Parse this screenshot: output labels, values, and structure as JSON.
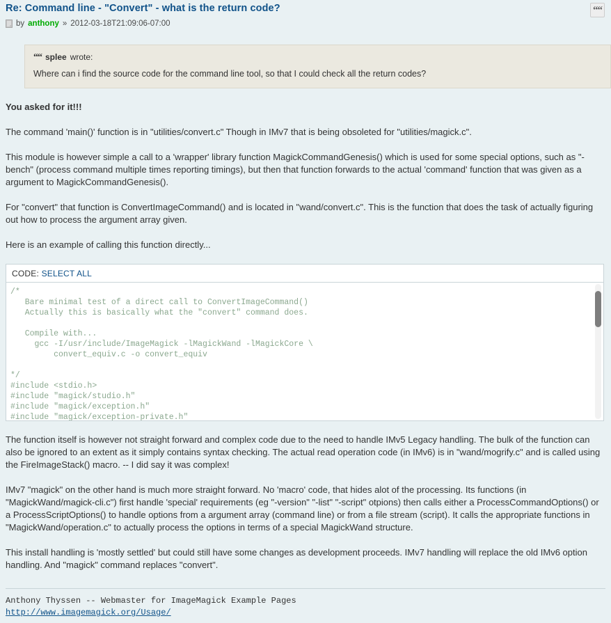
{
  "post": {
    "title": "Re: Command line - \"Convert\" - what is the return code?",
    "byline_prefix": "by",
    "author": "anthony",
    "separator": "»",
    "date": "2012-03-18T21:09:06-07:00",
    "post_icon_name": "post-page-icon",
    "quote_button_glyph": "“",
    "quote_button_name": "quote-post-button"
  },
  "quote": {
    "icon": "“",
    "attribution": "splee wrote:",
    "attribution_who": "splee",
    "attribution_verb": "wrote:",
    "text": "Where can i find the source code for the command line tool, so that I could check all the return codes?"
  },
  "body": {
    "p1": "You asked for it!!!",
    "p2": "The command 'main()' function is in \"utilities/convert.c\" Though in IMv7 that is being obsoleted for \"utilities/magick.c\".",
    "p3": "This module is however simple a call to a 'wrapper' library function MagickCommandGenesis() which is used for some special options, such as \"-bench\" (process command multiple times reporting timings), but then that function forwards to the actual 'command' function that was given as a argument to MagickCommandGenesis().",
    "p4": "For \"convert\" that function is ConvertImageCommand() and is located in \"wand/convert.c\". This is the function that does the task of actually figuring out how to process the argument array given.",
    "p5": "Here is an example of calling this function directly...",
    "p6": "The function itself is however not straight forward and complex code due to the need to handle IMv5 Legacy handling. The bulk of the function can also be ignored to an extent as it simply contains syntax checking. The actual read operation code (in IMv6) is in \"wand/mogrify.c\" and is called using the FireImageStack() macro. -- I did say it was complex!",
    "p7": "IMv7 \"magick\" on the other hand is much more straight forward. No 'macro' code, that hides alot of the processing. Its functions (in \"MagickWand/magick-cli.c\") first handle 'special' requirements (eg \"-version\" \"-list\" \"-script\" otpions) then calls either a ProcessCommandOptions() or a ProcessScriptOptions() to handle options from a argument array (command line) or from a file stream (script). It calls the appropriate functions in \"MagickWand/operation.c\" to actually process the options in terms of a special MagickWand structure.",
    "p8": "This install handling is 'mostly settled' but could still have some changes as development proceeds. IMv7 handling will replace the old IMv6 option handling. And \"magick\" command replaces \"convert\"."
  },
  "code_block": {
    "label": "CODE:",
    "select_all": "SELECT ALL",
    "content": "/*\n   Bare minimal test of a direct call to ConvertImageCommand()\n   Actually this is basically what the \"convert\" command does.\n\n   Compile with...\n     gcc -I/usr/include/ImageMagick -lMagickWand -lMagickCore \\\n         convert_equiv.c -o convert_equiv\n\n*/\n#include <stdio.h>\n#include \"magick/studio.h\"\n#include \"magick/exception.h\"\n#include \"magick/exception-private.h\"\n#include \"magick/MagickCore.h\""
  },
  "signature": {
    "line1": "Anthony Thyssen -- Webmaster for ImageMagick Example Pages",
    "link": "http://www.imagemagick.org/Usage/"
  }
}
